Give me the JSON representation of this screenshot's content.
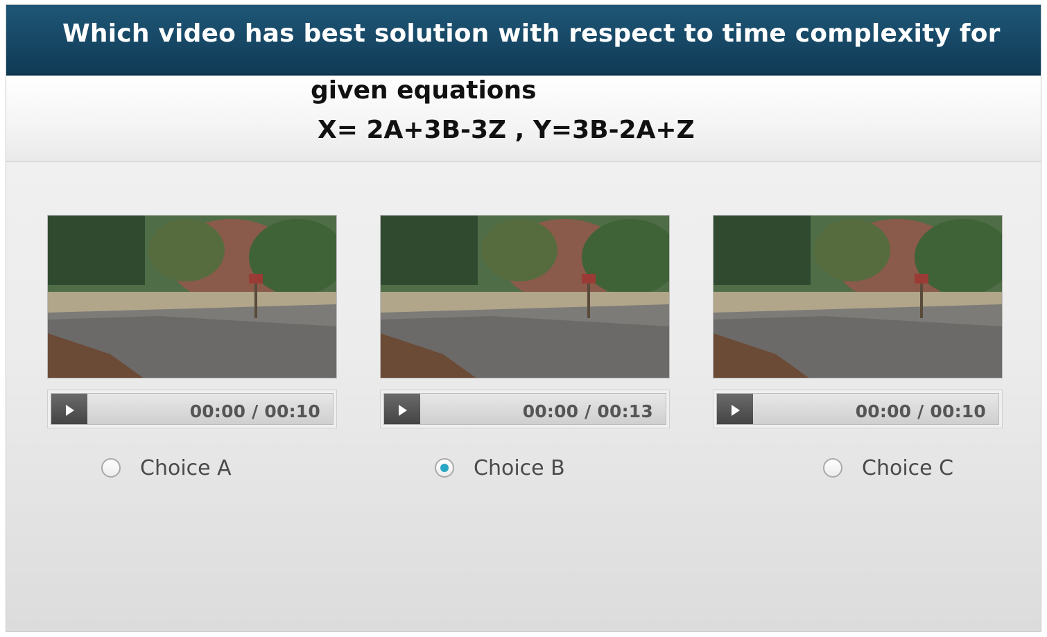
{
  "question": {
    "line1": "Which video has best solution with respect to time complexity  for",
    "line2": "given equations",
    "line3": "X= 2A+3B-3Z , Y=3B-2A+Z"
  },
  "videos": [
    {
      "time": "00:00 / 00:10",
      "choice_label": "Choice A",
      "selected": false
    },
    {
      "time": "00:00 / 00:13",
      "choice_label": "Choice B",
      "selected": true
    },
    {
      "time": "00:00 / 00:10",
      "choice_label": "Choice C",
      "selected": false
    }
  ],
  "colors": {
    "title_bar": "#184a68",
    "radio_selected": "#2aa7c5"
  },
  "icons": {
    "play": "play-icon"
  }
}
